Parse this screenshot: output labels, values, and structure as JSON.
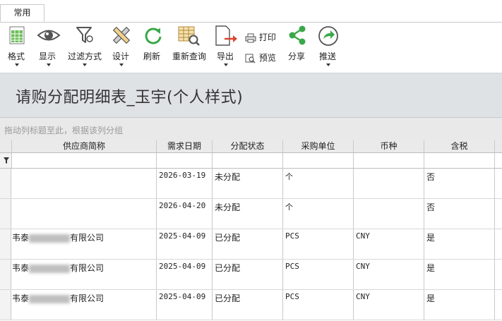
{
  "ribbon_tab": "常用",
  "toolbar": {
    "format": "格式",
    "display": "显示",
    "filter_mode": "过滤方式",
    "design": "设计",
    "refresh": "刷新",
    "requery": "重新查询",
    "export": "导出",
    "print": "打印",
    "preview": "预览",
    "share": "分享",
    "push": "推送"
  },
  "report_title": "请购分配明细表_玉宇(个人样式)",
  "group_bar_hint": "拖动列标题至此，根据该列分组",
  "columns": [
    "供应商简称",
    "需求日期",
    "分配状态",
    "采购单位",
    "币种",
    "含税"
  ],
  "rows": [
    {
      "supplier_a": "",
      "supplier_b": "",
      "date": "2026-03-19",
      "status": "未分配",
      "unit": "个",
      "currency": "",
      "tax": "否"
    },
    {
      "supplier_a": "",
      "supplier_b": "",
      "date": "2026-04-20",
      "status": "未分配",
      "unit": "个",
      "currency": "",
      "tax": "否"
    },
    {
      "supplier_a": "韦泰",
      "supplier_b": "有限公司",
      "date": "2025-04-09",
      "status": "已分配",
      "unit": "PCS",
      "currency": "CNY",
      "tax": "是"
    },
    {
      "supplier_a": "韦泰",
      "supplier_b": "有限公司",
      "date": "2025-04-09",
      "status": "已分配",
      "unit": "PCS",
      "currency": "CNY",
      "tax": "是"
    },
    {
      "supplier_a": "韦泰",
      "supplier_b": "有限公司",
      "date": "2025-04-09",
      "status": "已分配",
      "unit": "PCS",
      "currency": "CNY",
      "tax": "是"
    }
  ],
  "colors": {
    "title_band": "#dfe2e5",
    "group_bar": "#e9e9e9",
    "header_bg": "#eaeaea",
    "accent_green": "#3aa84a",
    "export_red": "#d9452f",
    "filter_icon": "#555555"
  },
  "icons": [
    "grid-format-icon",
    "eye-icon",
    "filter-funnel-icon",
    "design-tools-icon",
    "refresh-icon",
    "grid-search-icon",
    "export-icon",
    "printer-icon",
    "preview-icon",
    "share-icon",
    "push-arrow-icon",
    "filter-row-icon"
  ]
}
